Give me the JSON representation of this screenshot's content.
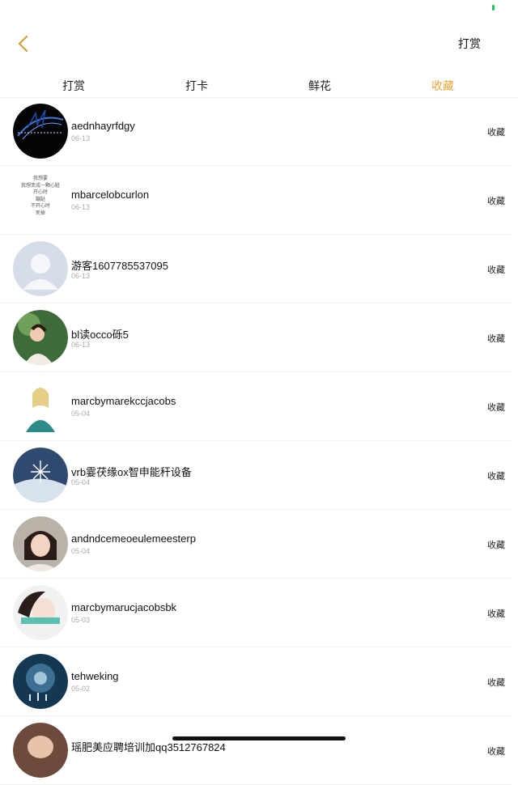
{
  "nav": {
    "action_label": "打赏"
  },
  "tabs": [
    {
      "label": "打赏",
      "active": false
    },
    {
      "label": "打卡",
      "active": false
    },
    {
      "label": "鲜花",
      "active": false
    },
    {
      "label": "收藏",
      "active": true
    }
  ],
  "rows": [
    {
      "name": "aednhayrfdgy",
      "date": "06-13",
      "action": "收藏"
    },
    {
      "name": "mbarcelobcurlon",
      "date": "06-13",
      "action": "收藏",
      "avatar_text": [
        "我想要",
        "我想变成一颗心脏",
        "开心时",
        "蹦跶",
        "不开心时",
        "死掉"
      ]
    },
    {
      "name": "游客1607785537095",
      "date": "06-13",
      "action": "收藏"
    },
    {
      "name": "bl读occo砾5",
      "date": "06-13",
      "action": "收藏"
    },
    {
      "name": "marcbymarekccjacobs",
      "date": "05-04",
      "action": "收藏"
    },
    {
      "name": "vrb霎茯缘ox智申能秆设备",
      "date": "05-04",
      "action": "收藏"
    },
    {
      "name": "andndcemeoeulemeesterp",
      "date": "05-04",
      "action": "收藏"
    },
    {
      "name": "marcbymarucjacobsbk",
      "date": "05-03",
      "action": "收藏"
    },
    {
      "name": "tehweking",
      "date": "05-02",
      "action": "收藏"
    },
    {
      "name": "瑶肥美应聘培训加qq3512767824",
      "date": "",
      "action": "收藏"
    }
  ],
  "colors": {
    "accent": "#e6a53a",
    "back": "#c9a23a"
  }
}
